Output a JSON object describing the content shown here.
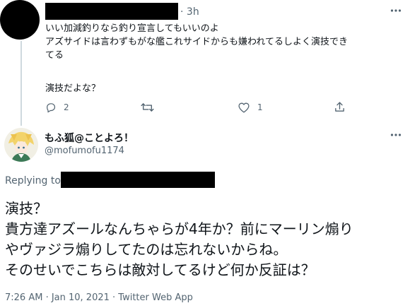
{
  "parent_tweet": {
    "time": "3h",
    "time_separator": "·",
    "text_lines": [
      "いい加減釣りなら釣り宣言してもいいのよ",
      "アズサイドは言わずもがな艦これサイドからも嫌われてるしよく演技でき",
      "てる",
      "",
      "演技だよな？"
    ],
    "actions": {
      "reply_count": "2",
      "retweet_count": "",
      "like_count": "1"
    }
  },
  "main_tweet": {
    "display_name": "もふ狐@ことよろ！",
    "handle": "@mofumofu1174",
    "replying_to_label": "Replying to",
    "body_lines": [
      "演技？",
      "貴方達アズールなんちゃらが4年か？前にマーリン煽り",
      "やヴァジラ煽りしてたのは忘れないからね。",
      "そのせいでこちらは敵対してるけど何か反証は？"
    ],
    "timestamp": "7:26 AM · Jan 10, 2021 · Twitter Web App"
  },
  "colors": {
    "text": "#0f1419",
    "muted": "#536471",
    "thread_line": "#cfd9de",
    "redaction": "#000000"
  }
}
